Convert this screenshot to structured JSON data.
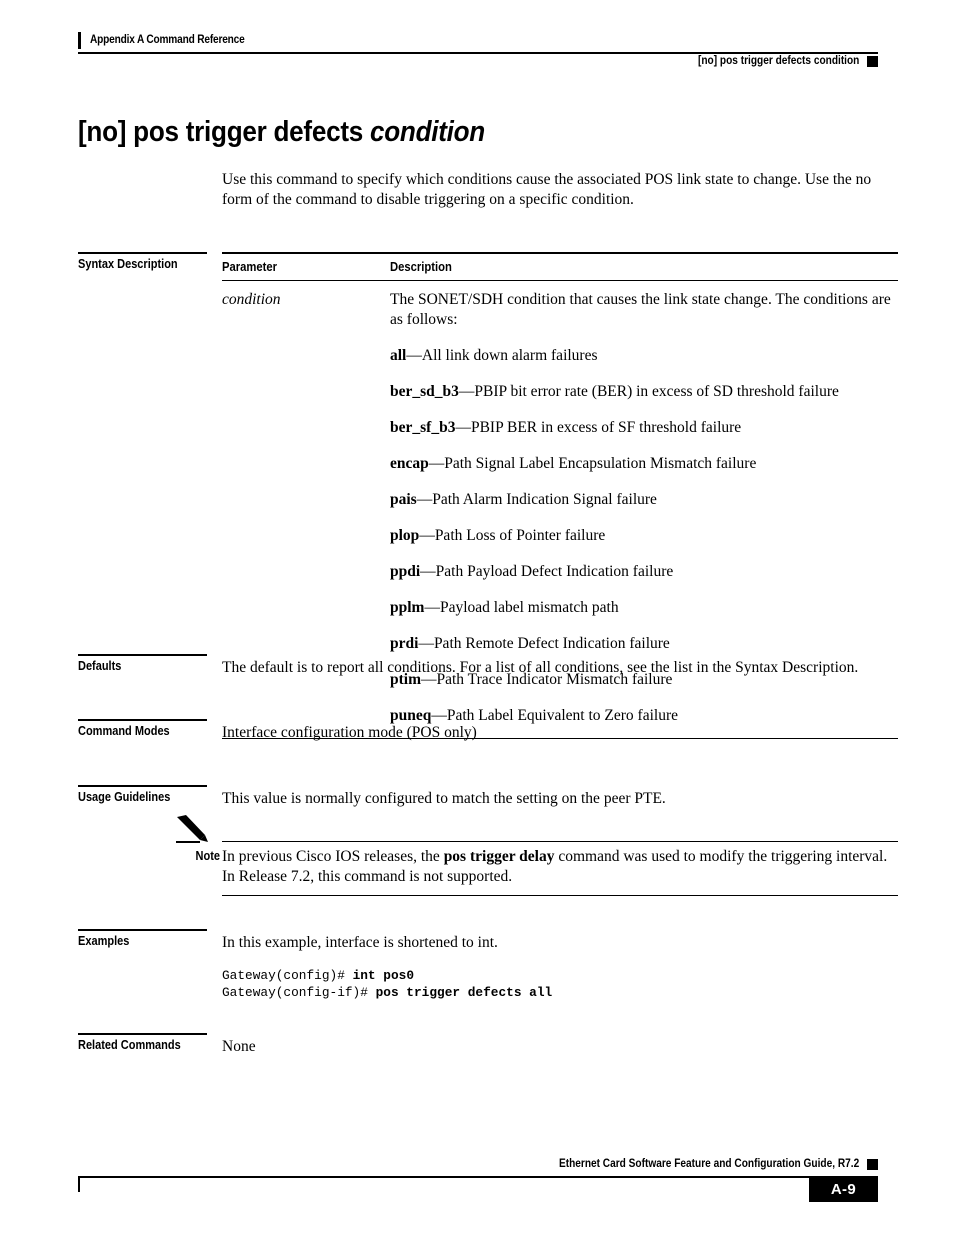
{
  "header": {
    "left_text": "Appendix A Command Reference",
    "right_text": "[no] pos trigger defects condition"
  },
  "command": {
    "title_main": "[no] pos trigger defects ",
    "title_italic": "condition",
    "intro": "Use this command to specify which conditions cause the associated POS link state to change. Use the no form of the command to disable triggering on a specific condition."
  },
  "syntax_description": {
    "label": "Syntax Description",
    "columns": {
      "parameter": "Parameter",
      "description": "Description"
    },
    "parameter": "condition",
    "description_intro": "The SONET/SDH condition that causes the link state change. The conditions are as follows:",
    "conditions": [
      {
        "term": "all",
        "text": "—All link down alarm failures"
      },
      {
        "term": "ber_sd_b3",
        "text": "—PBIP bit error rate (BER) in excess of SD threshold failure"
      },
      {
        "term": "ber_sf_b3",
        "text": "—PBIP BER in excess of SF threshold failure"
      },
      {
        "term": "encap",
        "text": "—Path Signal Label Encapsulation Mismatch failure"
      },
      {
        "term": "pais",
        "text": "—Path Alarm Indication Signal failure"
      },
      {
        "term": "plop",
        "text": "—Path Loss of Pointer failure"
      },
      {
        "term": "ppdi",
        "text": "—Path Payload Defect Indication failure"
      },
      {
        "term": "pplm",
        "text": "—Payload label mismatch path"
      },
      {
        "term": "prdi",
        "text": "—Path Remote Defect Indication failure"
      },
      {
        "term": "ptim",
        "text": "—Path Trace Indicator Mismatch failure"
      },
      {
        "term": "puneq",
        "text": "—Path Label Equivalent to Zero failure"
      }
    ]
  },
  "defaults": {
    "label": "Defaults",
    "text": "The default is to report all conditions. For a list of all conditions, see the list in the Syntax Description."
  },
  "command_modes": {
    "label": "Command Modes",
    "text": "Interface configuration mode (POS only)"
  },
  "usage_guidelines": {
    "label": "Usage Guidelines",
    "text": "This value is normally configured to match the setting on the peer PTE.",
    "note": {
      "label": "Note",
      "text_before": "In previous Cisco IOS releases, the ",
      "text_bold": "pos trigger delay",
      "text_after": " command was used to modify the triggering interval. In Release 7.2, this command is not supported."
    }
  },
  "examples": {
    "label": "Examples",
    "text": "In this example, interface is shortened to int.",
    "code_lines": [
      {
        "prompt": "Gateway(config)# ",
        "command": "int pos0"
      },
      {
        "prompt": "Gateway(config-if)# ",
        "command": "pos trigger defects all"
      }
    ]
  },
  "related_commands": {
    "label": "Related Commands",
    "text": "None"
  },
  "footer": {
    "title": "Ethernet Card Software Feature and Configuration Guide, R7.2",
    "page_number": "A-9"
  }
}
